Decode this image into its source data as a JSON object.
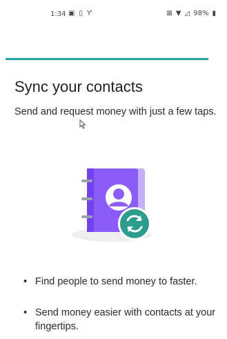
{
  "status_bar": {
    "time": "1:34",
    "battery": "98%"
  },
  "content": {
    "title": "Sync your contacts",
    "subtitle": "Send and request money with just a few taps.",
    "bullets": [
      "Find people to send money to faster.",
      "Send money easier with contacts at your fingertips."
    ]
  },
  "colors": {
    "accent": "#2ba39b",
    "book_purple": "#8b5cf6",
    "sync_badge": "#2c9d8c"
  },
  "icons": {
    "illustration": "contacts-book-sync-icon",
    "cursor": "mouse-cursor-icon"
  }
}
